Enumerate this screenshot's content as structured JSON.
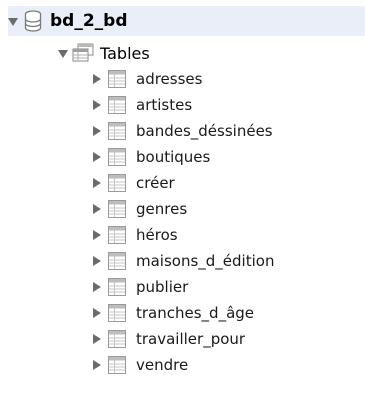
{
  "schema": {
    "name": "bd_2_bd",
    "icon": "database-icon",
    "expanded": true
  },
  "tables_group": {
    "label": "Tables",
    "icon": "tables-folder-icon",
    "expanded": true
  },
  "tables": [
    {
      "name": "adresses"
    },
    {
      "name": "artistes"
    },
    {
      "name": "bandes_déssinées"
    },
    {
      "name": "boutiques"
    },
    {
      "name": "créer"
    },
    {
      "name": "genres"
    },
    {
      "name": "héros"
    },
    {
      "name": "maisons_d_édition"
    },
    {
      "name": "publier"
    },
    {
      "name": "tranches_d_âge"
    },
    {
      "name": "travailler_pour"
    },
    {
      "name": "vendre"
    }
  ],
  "colors": {
    "schema_highlight": "#e9eef8",
    "toggle_arrow": "#6b6b6b",
    "table_icon_border": "#9a9a9a"
  }
}
